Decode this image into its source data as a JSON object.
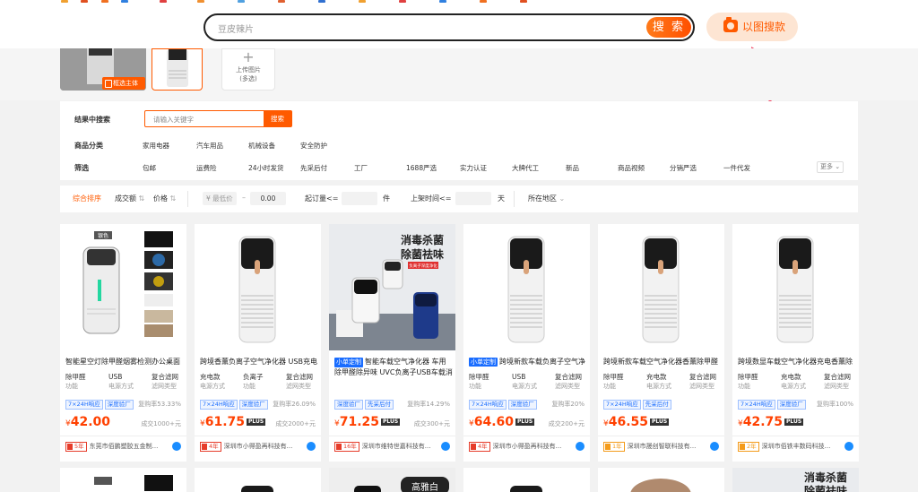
{
  "header": {
    "search_text": "豆皮辣片",
    "search_button": "搜 索",
    "image_search_button": "以图搜款"
  },
  "thumbnails": {
    "badge": "框选主体",
    "upload_line1": "上传图片",
    "upload_line2": "(多选)"
  },
  "filters": {
    "in_result_label": "结果中搜索",
    "in_result_placeholder": "请输入关键字",
    "in_result_button": "搜索",
    "category_label": "商品分类",
    "categories": [
      "家用电器",
      "汽车用品",
      "机械设备",
      "安全防护"
    ],
    "screen_label": "筛选",
    "screen_items": [
      "包邮",
      "运费险",
      "24小时发货",
      "先采后付",
      "工厂",
      "1688严选",
      "实力认证",
      "大牌代工",
      "新品",
      "商品视频",
      "分销严选",
      "一件代发"
    ],
    "more": "更多"
  },
  "sort": {
    "default": "综合排序",
    "deals": "成交额",
    "price": "价格",
    "price_min_placeholder": "¥ 最低价",
    "price_dash": "–",
    "price_max": "0.00",
    "moq": "起订量<=",
    "moq_unit": "件",
    "listed": "上架时间<=",
    "listed_unit": "天",
    "location": "所在地区"
  },
  "products": [
    {
      "new_tag": "",
      "title": "智能星空灯除甲醛烟雾检测办公桌面",
      "attrs": [
        [
          "除甲醛",
          "功能"
        ],
        [
          "USB",
          "电源方式"
        ],
        [
          "复合滤网",
          "滤网类型"
        ]
      ],
      "chips": [
        [
          "7×24H响应",
          "blue"
        ],
        [
          "深度验厂",
          "blue"
        ]
      ],
      "buy_rate": "复购率53.33%",
      "price": "42.00",
      "plus": "",
      "deals": "成交1000+元",
      "years": "5年",
      "shop": "东莞市佰鹏塑胶五金制..."
    },
    {
      "new_tag": "",
      "title": "跨境香薰负离子空气净化器 USB充电",
      "attrs": [
        [
          "充电款",
          "电源方式"
        ],
        [
          "负离子",
          "功能"
        ],
        [
          "复合滤网",
          "滤网类型"
        ]
      ],
      "chips": [
        [
          "7×24H响应",
          "blue"
        ],
        [
          "深度验厂",
          "blue"
        ]
      ],
      "buy_rate": "复购率26.09%",
      "price": "61.75",
      "plus": "PLUS",
      "deals": "成交2000+元",
      "years": "4年",
      "shop": "深圳市小得盈再科技有..."
    },
    {
      "new_tag": "小单定制",
      "title": "智能车载空气净化器 车用除甲醛除异味 UVC负离子USB车载消",
      "attrs": [],
      "chips": [
        [
          "深度验厂",
          "blue"
        ],
        [
          "先采后付",
          "blue"
        ]
      ],
      "buy_rate": "复购率14.29%",
      "price": "71.25",
      "plus": "PLUS",
      "deals": "成交300+元",
      "years": "16年",
      "shop": "深圳市维特世嘉科技有..."
    },
    {
      "new_tag": "小单定制",
      "title": "跨境新款车载负离子空气净",
      "attrs": [
        [
          "除甲醛",
          "功能"
        ],
        [
          "USB",
          "电源方式"
        ],
        [
          "复合滤网",
          "滤网类型"
        ]
      ],
      "chips": [
        [
          "7×24H响应",
          "blue"
        ],
        [
          "深度验厂",
          "blue"
        ]
      ],
      "buy_rate": "复购率20%",
      "price": "64.60",
      "plus": "PLUS",
      "deals": "成交200+元",
      "years": "4年",
      "shop": "深圳市小得盈再科技有..."
    },
    {
      "new_tag": "",
      "title": "跨境新款车载空气净化器香薰除甲醛",
      "attrs": [
        [
          "除甲醛",
          "功能"
        ],
        [
          "充电款",
          "电源方式"
        ],
        [
          "复合滤网",
          "滤网类型"
        ]
      ],
      "chips": [
        [
          "7×24H响应",
          "blue"
        ],
        [
          "先采后付",
          "blue"
        ]
      ],
      "buy_rate": "",
      "price": "46.55",
      "plus": "PLUS",
      "deals": "",
      "years": "1年",
      "years_gold": true,
      "shop": "深圳市晟创智联科技有..."
    },
    {
      "new_tag": "",
      "title": "跨境数显车载空气净化器充电香薰除",
      "attrs": [
        [
          "除甲醛",
          "功能"
        ],
        [
          "充电款",
          "电源方式"
        ],
        [
          "复合滤网",
          "滤网类型"
        ]
      ],
      "chips": [
        [
          "7×24H响应",
          "blue"
        ],
        [
          "深度验厂",
          "blue"
        ]
      ],
      "buy_rate": "复购率100%",
      "price": "42.75",
      "plus": "PLUS",
      "deals": "",
      "years": "2年",
      "years_gold": true,
      "shop": "深圳市佰铁丰数码科技..."
    }
  ],
  "banners": {
    "p3_line1": "消毒杀菌",
    "p3_line2": "除菌祛味",
    "p3_sub": "负离子深度净化",
    "first_thumb_badge": "银色",
    "row2_p3": "高雅白",
    "row2_p6_line1": "消毒杀菌",
    "row2_p6_line2": "除菌祛味"
  }
}
